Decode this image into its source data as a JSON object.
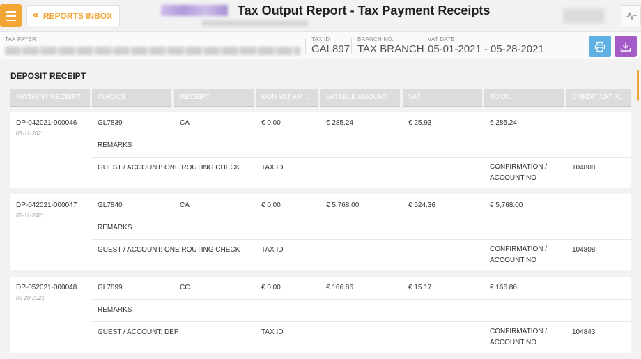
{
  "header": {
    "title": "Tax Output Report - Tax Payment Receipts",
    "inbox_button": "REPORTS INBOX"
  },
  "info": {
    "taxpayer_label": "TAX PAYER",
    "taxid_label": "TAX ID",
    "taxid_value": "GAL897",
    "branch_label": "BRANCH NO.",
    "branch_value": "TAX BRANCH",
    "vatdate_label": "VAT DATE",
    "vatdate_value": "05-01-2021 - 05-28-2021"
  },
  "section": {
    "title": "DEPOSIT RECEIPT"
  },
  "columns": [
    "PAYMENT RECEIPT",
    "INVOICE",
    "RECEIPT",
    "NON VAT AM...",
    "VATABLE AMOUNT",
    "VAT",
    "TOTAL",
    "CREDIT VAT R..."
  ],
  "rows": [
    {
      "payment_receipt": "DP-042021-000046",
      "date": "05-11-2021",
      "invoice": "GL7839",
      "receipt": "CA",
      "non_vat": "€ 0.00",
      "vatable": "€ 285.24",
      "vat": "€ 25.93",
      "total": "€ 285.24",
      "remarks": "REMARKS",
      "guest": "GUEST / ACCOUNT: ONE ROUTING CHECK",
      "taxid": "TAX ID",
      "confirmation": "CONFIRMATION / ACCOUNT NO",
      "account_no": "104808"
    },
    {
      "payment_receipt": "DP-042021-000047",
      "date": "05-11-2021",
      "invoice": "GL7840",
      "receipt": "CA",
      "non_vat": "€ 0.00",
      "vatable": "€ 5,768.00",
      "vat": "€ 524.36",
      "total": "€ 5,768.00",
      "remarks": "REMARKS",
      "guest": "GUEST / ACCOUNT: ONE ROUTING CHECK",
      "taxid": "TAX ID",
      "confirmation": "CONFIRMATION / ACCOUNT NO",
      "account_no": "104808"
    },
    {
      "payment_receipt": "DP-052021-000048",
      "date": "05-20-2021",
      "invoice": "GL7899",
      "receipt": "CC",
      "non_vat": "€ 0.00",
      "vatable": "€ 166.86",
      "vat": "€ 15.17",
      "total": "€ 166.86",
      "remarks": "REMARKS",
      "guest": "GUEST / ACCOUNT: DEP",
      "taxid": "TAX ID",
      "confirmation": "CONFIRMATION / ACCOUNT NO",
      "account_no": "104843"
    }
  ],
  "colors": {
    "accent": "#f3a536",
    "print": "#5fb0e3",
    "download": "#a45ac7",
    "header_cell": "#dcdcdc"
  },
  "icons": [
    "menu-icon",
    "double-chevron-left-icon",
    "pulse-icon",
    "printer-icon",
    "download-icon"
  ]
}
